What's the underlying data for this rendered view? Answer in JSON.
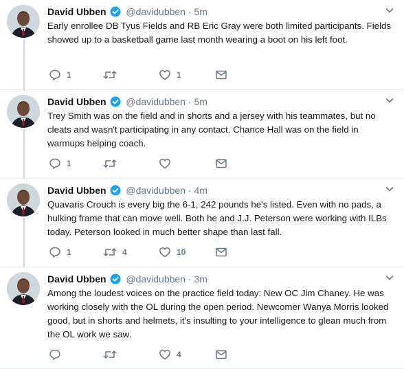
{
  "colors": {
    "verified": "#1da1f2",
    "icon": "#657786",
    "text": "#14171a",
    "muted": "#657786",
    "divider": "#e6ecf0",
    "thread_line": "#ccd6dd"
  },
  "tweets": [
    {
      "name": "David Ubben",
      "handle": "@davidubben",
      "dot": "·",
      "time": "5m",
      "text": "Early enrollee DB Tyus Fields and RB Eric Gray were both limited participants. Fields showed up to a basketball game last month wearing a boot on his left foot.",
      "replies": "1",
      "retweets": "",
      "likes": "1"
    },
    {
      "name": "David Ubben",
      "handle": "@davidubben",
      "dot": "·",
      "time": "5m",
      "text": "Trey Smith was on the field and in shorts and a jersey with his teammates, but no cleats and wasn't participating in any contact. Chance Hall was on the field in warmups helping coach.",
      "replies": "1",
      "retweets": "",
      "likes": ""
    },
    {
      "name": "David Ubben",
      "handle": "@davidubben",
      "dot": "·",
      "time": "4m",
      "text": "Quavaris Crouch is every big the 6-1, 242 pounds he's listed. Even with no pads, a hulking frame that can move well. Both he and J.J. Peterson were working with ILBs today. Peterson looked in much better shape than last fall.",
      "replies": "1",
      "retweets": "4",
      "likes": "10"
    },
    {
      "name": "David Ubben",
      "handle": "@davidubben",
      "dot": "·",
      "time": "3m",
      "text": "Among the loudest voices on the practice field today: New OC Jim Chaney. He was working closely with the OL during the open period. Newcomer Wanya Morris looked good, but in shorts and helmets, it's insulting to your intelligence to glean much from the OL work we saw.",
      "replies": "",
      "retweets": "",
      "likes": "4"
    }
  ]
}
